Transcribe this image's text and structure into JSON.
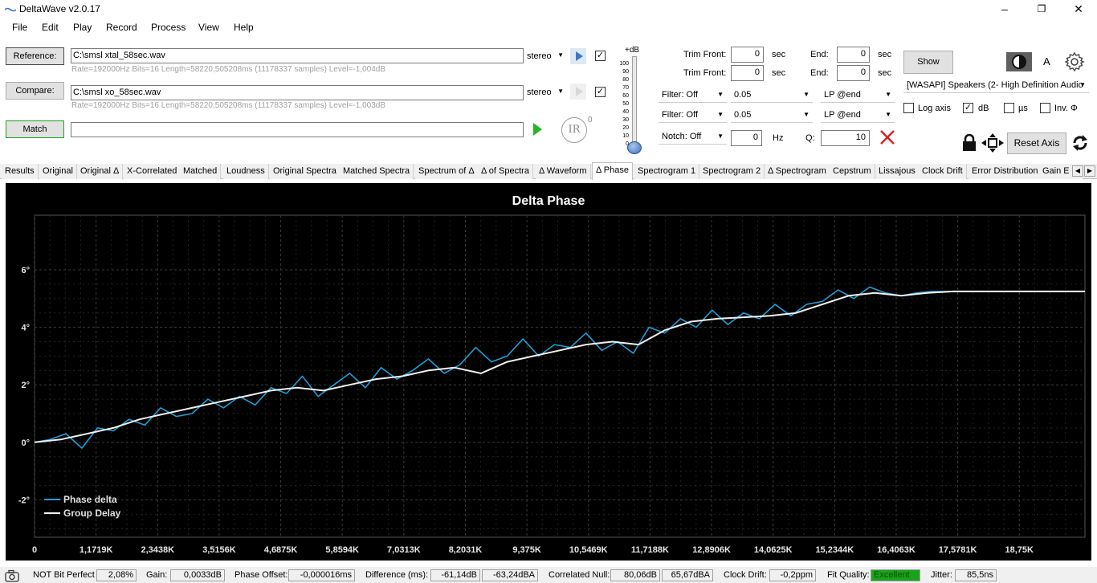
{
  "window": {
    "title": "DeltaWave v2.0.17",
    "controls": {
      "minimize": "–",
      "maximize": "❐",
      "close": "✕"
    }
  },
  "menu": [
    "File",
    "Edit",
    "Play",
    "Record",
    "Process",
    "View",
    "Help"
  ],
  "reference": {
    "button": "Reference:",
    "path": "C:\\smsl xtal_58sec.wav",
    "info": "Rate=192000Hz Bits=16 Length=58220,505208ms (11178337 samples) Level=-1,004dB",
    "channel": "stereo",
    "checked": true
  },
  "compare": {
    "button": "Compare:",
    "path": "C:\\smsl xo_58sec.wav",
    "info": "Rate=192000Hz Bits=16 Length=58220,505208ms (11178337 samples) Level=-1,003dB",
    "channel": "stereo",
    "checked": true
  },
  "match": {
    "button": "Match",
    "ir_label": "IR",
    "ir_sup": "0"
  },
  "level_slider": {
    "unit": "+dB",
    "ticks": [
      "100",
      "90",
      "80",
      "70",
      "60",
      "50",
      "40",
      "30",
      "20",
      "10",
      "0"
    ],
    "value": 0
  },
  "trim": [
    {
      "front_label": "Trim Front:",
      "front_value": "0",
      "front_unit": "sec",
      "end_label": "End:",
      "end_value": "0",
      "end_unit": "sec"
    },
    {
      "front_label": "Trim Front:",
      "front_value": "0",
      "front_unit": "sec",
      "end_label": "End:",
      "end_value": "0",
      "end_unit": "sec"
    }
  ],
  "filters": [
    {
      "filter": "Filter: Off",
      "value": "0.05",
      "lp": "LP @end"
    },
    {
      "filter": "Filter: Off",
      "value": "0.05",
      "lp": "LP @end"
    }
  ],
  "notch": {
    "label": "Notch: Off",
    "value": "0",
    "unit": "Hz",
    "q_label": "Q:",
    "q_value": "10"
  },
  "show_button": "Show",
  "font_label": "A",
  "output_device": "[WASAPI] Speakers (2- High Definition Audio",
  "options": [
    {
      "label": "Log axis",
      "checked": false
    },
    {
      "label": "dB",
      "checked": true
    },
    {
      "label": "µs",
      "checked": false
    },
    {
      "label": "Inv. Φ",
      "checked": false
    }
  ],
  "reset_axis": "Reset Axis",
  "tabs": [
    "Results",
    "Original",
    "Original Δ",
    "X-Correlated",
    "Matched",
    "Loudness",
    "Original Spectra",
    "Matched Spectra",
    "Spectrum of Δ",
    "Δ of Spectra",
    "Δ Waveform",
    "Δ Phase",
    "Spectrogram 1",
    "Spectrogram 2",
    "Δ Spectrogram",
    "Cepstrum",
    "Lissajous",
    "Clock Drift",
    "Error Distribution",
    "Gain E"
  ],
  "selected_tab": "Δ Phase",
  "colors": {
    "phase_delta": "#1e9fd8",
    "group_delay": "#f0f0f0",
    "chart_bg": "#000000",
    "grid": "#3a3a3a",
    "fit_quality": "#1aa31a"
  },
  "chart_data": {
    "type": "line",
    "title": "Delta Phase",
    "xlabel": "",
    "ylabel": "",
    "xlim": [
      0,
      20000
    ],
    "ylim": [
      -3.3,
      7.9
    ],
    "x_ticks": [
      "0",
      "1,1719K",
      "2,3438K",
      "3,5156K",
      "4,6875K",
      "5,8594K",
      "7,0313K",
      "8,2031K",
      "9,375K",
      "10,5469K",
      "11,7188K",
      "12,8906K",
      "14,0625K",
      "15,2344K",
      "16,4063K",
      "17,5781K",
      "18,75K"
    ],
    "y_ticks": [
      "6°",
      "4°",
      "2°",
      "0°",
      "-2°"
    ],
    "legend_position": "bottom-left",
    "series": [
      {
        "name": "Phase delta",
        "x": [
          0,
          300,
          600,
          900,
          1200,
          1500,
          1800,
          2100,
          2400,
          2700,
          3000,
          3300,
          3600,
          3900,
          4200,
          4500,
          4800,
          5100,
          5400,
          5700,
          6000,
          6300,
          6600,
          6900,
          7200,
          7500,
          7800,
          8100,
          8400,
          8700,
          9000,
          9300,
          9600,
          9900,
          10200,
          10500,
          10800,
          11100,
          11400,
          11700,
          12000,
          12300,
          12600,
          12900,
          13200,
          13500,
          13800,
          14100,
          14400,
          14700,
          15000,
          15300,
          15600,
          15900,
          16200,
          16500,
          16800,
          17100,
          17400,
          17700,
          18000,
          18300,
          18600,
          18900,
          19200,
          19500,
          19800,
          20000
        ],
        "y": [
          0.0,
          0.1,
          0.3,
          -0.2,
          0.5,
          0.4,
          0.8,
          0.6,
          1.2,
          0.9,
          1.0,
          1.5,
          1.2,
          1.6,
          1.3,
          1.9,
          1.7,
          2.3,
          1.6,
          2.0,
          2.4,
          1.9,
          2.6,
          2.2,
          2.5,
          2.9,
          2.4,
          2.7,
          3.3,
          2.8,
          3.0,
          3.6,
          3.0,
          3.4,
          3.3,
          3.8,
          3.2,
          3.5,
          3.1,
          4.0,
          3.8,
          4.3,
          4.0,
          4.6,
          4.1,
          4.5,
          4.3,
          4.8,
          4.4,
          4.8,
          4.9,
          5.3,
          5.0,
          5.4,
          5.2,
          5.1,
          5.2,
          5.25,
          5.25,
          5.25,
          5.25,
          5.25,
          5.25,
          5.25,
          5.25,
          5.25,
          5.25,
          5.25
        ]
      },
      {
        "name": "Group Delay",
        "x": [
          0,
          500,
          1000,
          1500,
          2000,
          2500,
          3000,
          3500,
          4000,
          4500,
          5000,
          5500,
          6000,
          6500,
          7000,
          7500,
          8000,
          8500,
          9000,
          9500,
          10000,
          10500,
          11000,
          11500,
          12000,
          12500,
          13000,
          13500,
          14000,
          14500,
          15000,
          15500,
          16000,
          16500,
          17000,
          17500,
          18000,
          18500,
          19000,
          19500,
          20000
        ],
        "y": [
          0.0,
          0.1,
          0.3,
          0.5,
          0.8,
          1.0,
          1.2,
          1.4,
          1.6,
          1.8,
          1.9,
          1.8,
          2.0,
          2.2,
          2.3,
          2.5,
          2.6,
          2.4,
          2.8,
          3.0,
          3.2,
          3.4,
          3.5,
          3.4,
          3.9,
          4.2,
          4.3,
          4.35,
          4.4,
          4.5,
          4.8,
          5.1,
          5.2,
          5.1,
          5.2,
          5.25,
          5.25,
          5.25,
          5.25,
          5.25,
          5.25
        ]
      }
    ]
  },
  "status": {
    "bit_perfect": "NOT Bit Perfect",
    "bit_perfect_value": "2,08%",
    "gain_label": "Gain:",
    "gain_value": "0,0033dB",
    "phase_offset_label": "Phase Offset:",
    "phase_offset_value": "-0,000016ms",
    "difference_label": "Difference (ms):",
    "difference_value1": "-61,14dB",
    "difference_value2": "-63,24dBA",
    "correlated_null_label": "Correlated Null:",
    "correlated_null_value1": "80,06dB",
    "correlated_null_value2": "65,67dBA",
    "clock_drift_label": "Clock Drift:",
    "clock_drift_value": "-0,2ppm",
    "fit_quality_label": "Fit Quality:",
    "fit_quality_value": "Excellent",
    "jitter_label": "Jitter:",
    "jitter_value": "85,5ns"
  }
}
